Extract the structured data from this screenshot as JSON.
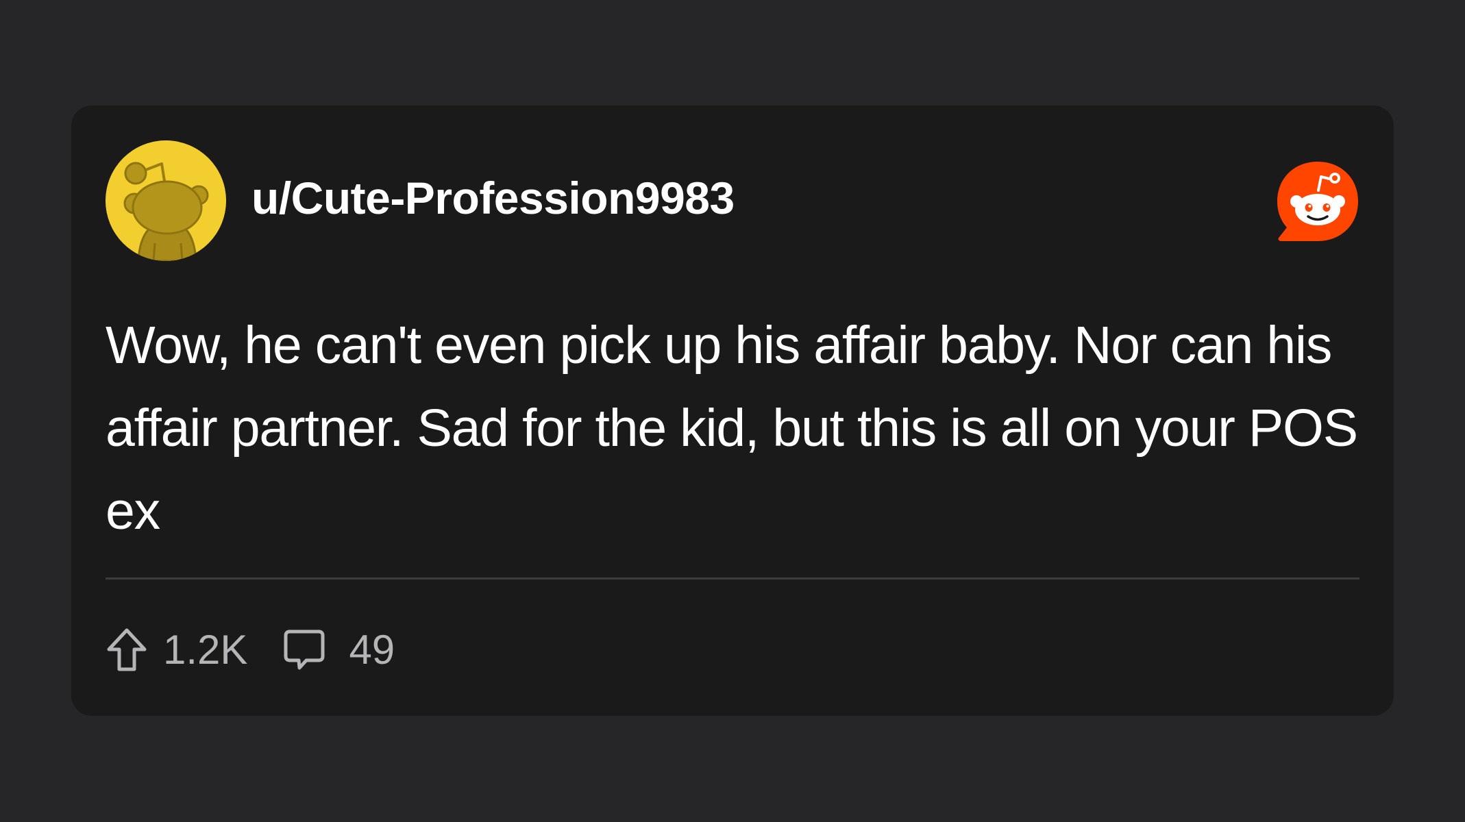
{
  "post": {
    "username": "u/Cute-Profession9983",
    "body": "Wow, he can't even pick up his affair baby. Nor can his affair partner. Sad for the kid, but this is all on your POS ex",
    "upvotes": "1.2K",
    "comments": "49"
  },
  "icons": {
    "avatar": "snoo-avatar-icon",
    "brand": "reddit-logo-icon",
    "upvote": "upvote-arrow-icon",
    "comment": "comment-bubble-icon"
  },
  "colors": {
    "page_background": "#262628",
    "card_background": "#1a1a1b",
    "avatar_background": "#f2cf2e",
    "reddit_orange": "#ff4500",
    "text_primary": "#ffffff",
    "text_secondary": "#b5b5b7",
    "divider": "#3c3c3e"
  }
}
